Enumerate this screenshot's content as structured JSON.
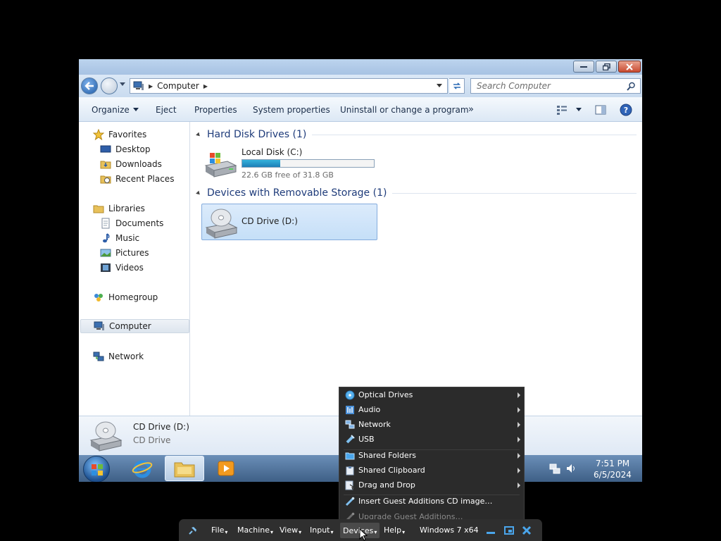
{
  "explorer": {
    "address_crumb": "Computer",
    "search_placeholder": "Search Computer",
    "toolbar": {
      "organize": "Organize",
      "eject": "Eject",
      "properties": "Properties",
      "system_properties": "System properties",
      "uninstall": "Uninstall or change a program",
      "more": "»"
    },
    "nav": {
      "favorites": "Favorites",
      "desktop": "Desktop",
      "downloads": "Downloads",
      "recent_places": "Recent Places",
      "libraries": "Libraries",
      "documents": "Documents",
      "music": "Music",
      "pictures": "Pictures",
      "videos": "Videos",
      "homegroup": "Homegroup",
      "computer": "Computer",
      "network": "Network"
    },
    "groups": {
      "hdd": "Hard Disk Drives (1)",
      "removable": "Devices with Removable Storage (1)"
    },
    "drive_c": {
      "label": "Local Disk (C:)",
      "free_text": "22.6 GB free of 31.8 GB",
      "used_fraction": 0.29
    },
    "drive_d": {
      "label": "CD Drive (D:)"
    },
    "details": {
      "name": "CD Drive (D:)",
      "type": "CD Drive"
    },
    "taskbar": {
      "time": "7:51 PM",
      "date": "6/5/2024"
    }
  },
  "vbox": {
    "menu_items": {
      "optical": "Optical Drives",
      "audio": "Audio",
      "network": "Network",
      "usb": "USB",
      "shared_folders": "Shared Folders",
      "shared_clipboard": "Shared Clipboard",
      "drag_drop": "Drag and Drop",
      "insert_ga": "Insert Guest Additions CD image…",
      "upgrade_ga": "Upgrade Guest Additions…"
    },
    "bar": {
      "file": "File",
      "machine": "Machine",
      "view": "View",
      "input": "Input",
      "devices": "Devices",
      "help": "Help",
      "vm_name": "Windows 7 x64"
    }
  }
}
